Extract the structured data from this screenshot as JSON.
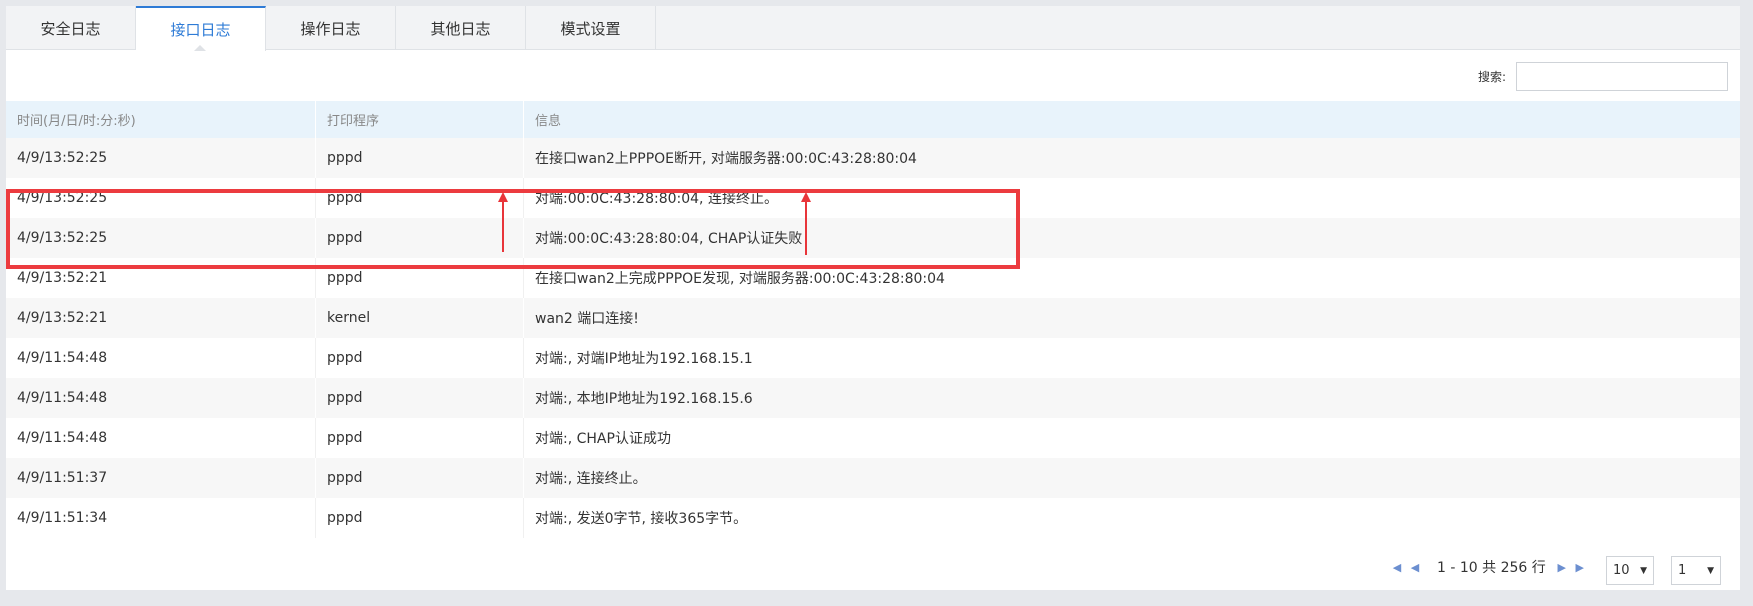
{
  "tabs": [
    {
      "label": "安全日志",
      "active": false
    },
    {
      "label": "接口日志",
      "active": true
    },
    {
      "label": "操作日志",
      "active": false
    },
    {
      "label": "其他日志",
      "active": false
    },
    {
      "label": "模式设置",
      "active": false
    }
  ],
  "search": {
    "label": "搜索:",
    "value": "",
    "placeholder": ""
  },
  "table": {
    "headers": [
      "时间(月/日/时:分:秒)",
      "打印程序",
      "信息"
    ],
    "rows": [
      {
        "time": "4/9/13:52:25",
        "program": "pppd",
        "info": "在接口wan2上PPPOE断开, 对端服务器:00:0C:43:28:80:04"
      },
      {
        "time": "4/9/13:52:25",
        "program": "pppd",
        "info": "对端:00:0C:43:28:80:04, 连接终止。"
      },
      {
        "time": "4/9/13:52:25",
        "program": "pppd",
        "info": "对端:00:0C:43:28:80:04, CHAP认证失败"
      },
      {
        "time": "4/9/13:52:21",
        "program": "pppd",
        "info": "在接口wan2上完成PPPOE发现, 对端服务器:00:0C:43:28:80:04"
      },
      {
        "time": "4/9/13:52:21",
        "program": "kernel",
        "info": "wan2 端口连接!"
      },
      {
        "time": "4/9/11:54:48",
        "program": "pppd",
        "info": "对端:, 对端IP地址为192.168.15.1"
      },
      {
        "time": "4/9/11:54:48",
        "program": "pppd",
        "info": "对端:, 本地IP地址为192.168.15.6"
      },
      {
        "time": "4/9/11:54:48",
        "program": "pppd",
        "info": "对端:, CHAP认证成功"
      },
      {
        "time": "4/9/11:51:37",
        "program": "pppd",
        "info": "对端:, 连接终止。"
      },
      {
        "time": "4/9/11:51:34",
        "program": "pppd",
        "info": "对端:, 发送0字节, 接收365字节。"
      }
    ]
  },
  "pagination": {
    "info": "1 - 10 共 256 行",
    "page_size": "10",
    "page": "1",
    "first_icon": "first-page-icon",
    "prev_icon": "prev-page-icon",
    "next_icon": "next-page-icon",
    "last_icon": "last-page-icon"
  },
  "colors": {
    "accent": "#2e7bd6",
    "header_bg": "#e8f3fb",
    "annotation": "#ec3b3f"
  }
}
